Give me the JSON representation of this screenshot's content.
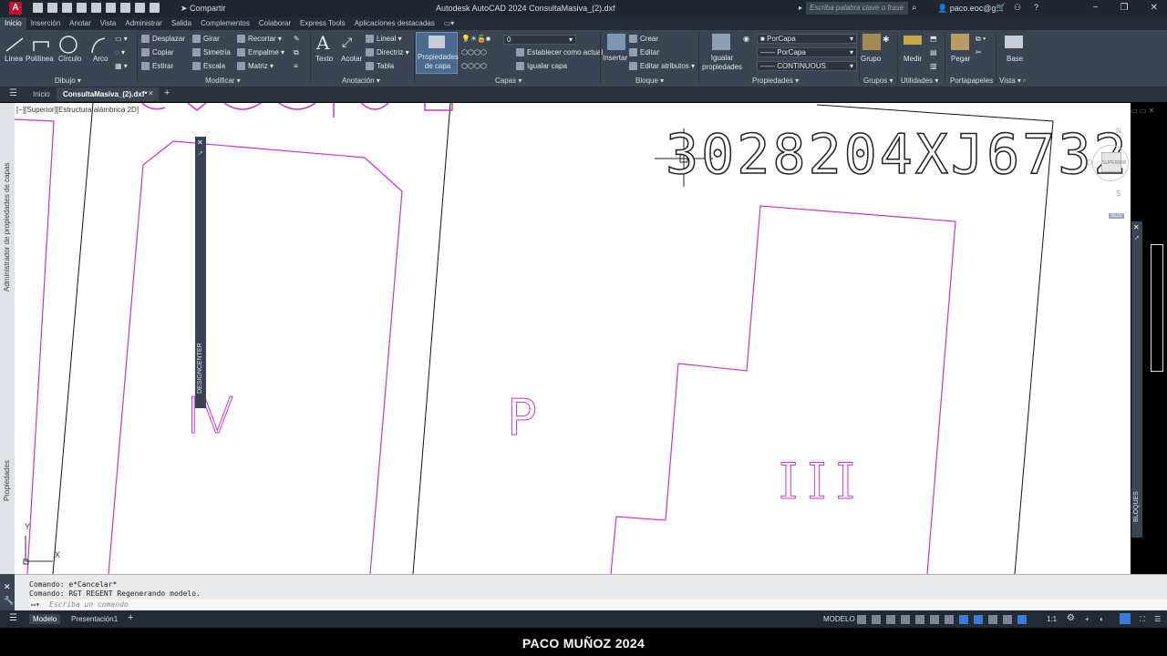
{
  "title_bar": {
    "app_logo": "A",
    "share_label": "Compartir",
    "title": "Autodesk AutoCAD 2024   ConsultaMasiva_(2).dxf",
    "search_placeholder": "Escriba palabra clave o frase",
    "user": "paco.eoc@g..."
  },
  "menu_tabs": [
    "Inicio",
    "Inserción",
    "Anotar",
    "Vista",
    "Administrar",
    "Salida",
    "Complementos",
    "Colaborar",
    "Express Tools",
    "Aplicaciones destacadas"
  ],
  "ribbon": {
    "draw": {
      "title": "Dibujo",
      "linea": "Línea",
      "polilinea": "Polilínea",
      "circulo": "Círculo",
      "arco": "Arco"
    },
    "modify": {
      "title": "Modificar",
      "desplazar": "Desplazar",
      "copiar": "Copiar",
      "estirar": "Estirar",
      "girar": "Girar",
      "simetria": "Simetría",
      "escala": "Escala",
      "recortar": "Recortar",
      "empalme": "Empalme",
      "matriz": "Matriz"
    },
    "annotation": {
      "title": "Anotación",
      "texto": "Texto",
      "acotar": "Acotar",
      "lineal": "Lineal",
      "directriz": "Directriz",
      "tabla": "Tabla"
    },
    "layers": {
      "title": "Capas",
      "propiedades_capa": "Propiedades de capa",
      "layer_value": "0",
      "establecer": "Establecer como actual",
      "igualar_capa": "Igualar capa"
    },
    "block": {
      "title": "Bloque",
      "insertar": "Insertar",
      "crear": "Crear",
      "editar": "Editar",
      "editar_atributos": "Editar atributos"
    },
    "properties": {
      "title": "Propiedades",
      "igualar": "Igualar propiedades",
      "color": "PorCapa",
      "linetype": "PorCapa",
      "lineweight": "CONTINUOUS"
    },
    "groups": {
      "title": "Grupos",
      "grupo": "Grupo"
    },
    "utilities": {
      "title": "Utilidades",
      "medir": "Medir"
    },
    "clipboard": {
      "title": "Portapapeles",
      "pegar": "Pegar"
    },
    "view": {
      "title": "Vista",
      "base": "Base"
    }
  },
  "doc_tabs": {
    "start": "Inicio",
    "active": "ConsultaMasiva_(2).dxf*"
  },
  "viewport": {
    "label": "[−][Superior][Estructura alámbrica 2D]",
    "parcel_id": "3028204XJ6732",
    "top_partial": "2 0 0 0 2 0 2 0",
    "zones": {
      "iv": "IV",
      "p": "P",
      "iii": "III"
    },
    "viewcube": {
      "north": "N",
      "south": "S",
      "top": "SUPERIOR",
      "west": "O",
      "ucs": "SCU"
    },
    "axis_x": "X",
    "axis_y": "Y"
  },
  "left_palettes": {
    "layer_manager": "Administrador de propiedades de capas",
    "properties": "Propiedades"
  },
  "designcenter_label": "DESIGNCENTER",
  "blocks_label": "BLOQUES",
  "command": {
    "line1": "Comando: e*Cancelar*",
    "line2": "Comando: RGT REGENT Regenerando modelo.",
    "placeholder": "Escriba un comando"
  },
  "status_bar": {
    "model_tab": "Modelo",
    "layout_tab": "Presentación1",
    "space": "MODELO",
    "scale": "1:1"
  },
  "watermark": "PACO MUÑOZ  2024"
}
